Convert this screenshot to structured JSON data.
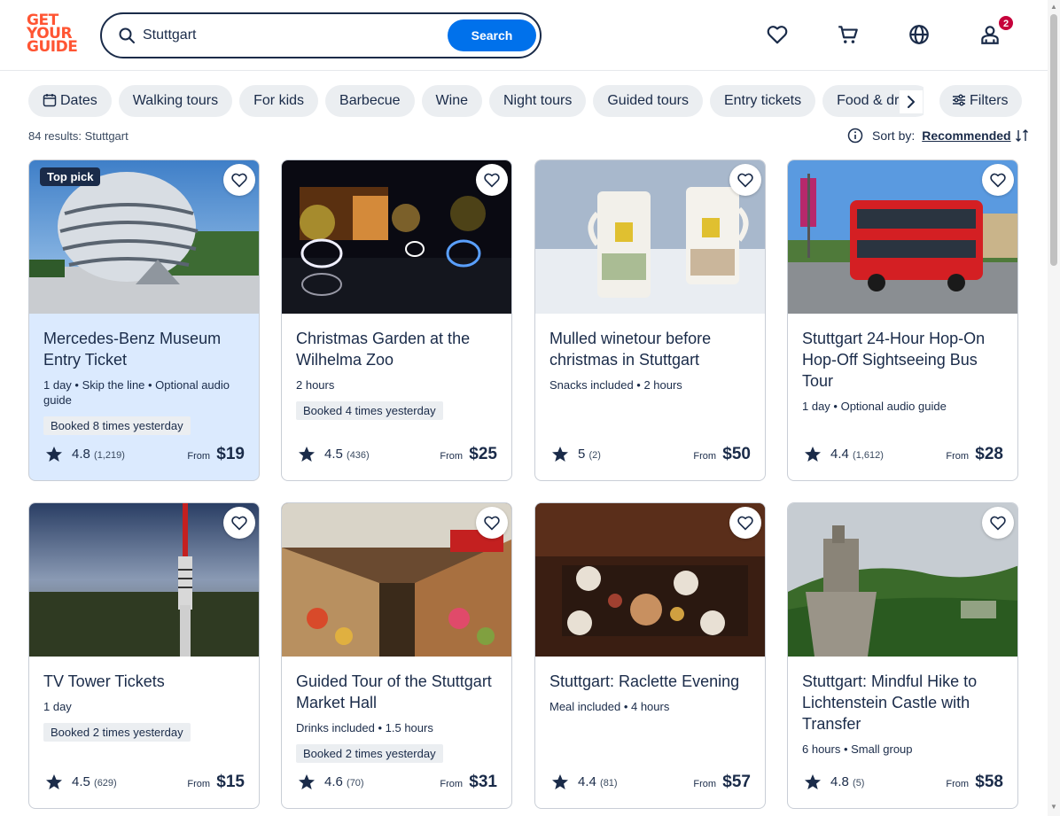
{
  "header": {
    "logo_lines": [
      "GET",
      "YOUR",
      "GUIDE"
    ],
    "search": {
      "value": "Stuttgart",
      "button_label": "Search"
    },
    "cart_badge": "2"
  },
  "chips": [
    {
      "label": "Dates",
      "icon": "calendar-icon"
    },
    {
      "label": "Walking tours"
    },
    {
      "label": "For kids"
    },
    {
      "label": "Barbecue"
    },
    {
      "label": "Wine"
    },
    {
      "label": "Night tours"
    },
    {
      "label": "Guided tours"
    },
    {
      "label": "Entry tickets"
    },
    {
      "label": "Food & drink"
    }
  ],
  "filters_label": "Filters",
  "results_text": "84 results: Stuttgart",
  "sort": {
    "label": "Sort by:",
    "value": "Recommended"
  },
  "cards": [
    {
      "title": "Mercedes-Benz Museum Entry Ticket",
      "meta": "1 day • Skip the line • Optional audio guide",
      "booked": "Booked 8 times yesterday",
      "rating": "4.8",
      "count": "(1,219)",
      "from": "From",
      "price": "$19",
      "badge": "Top pick"
    },
    {
      "title": "Christmas Garden at the Wilhelma Zoo",
      "meta": "2 hours",
      "booked": "Booked 4 times yesterday",
      "rating": "4.5",
      "count": "(436)",
      "from": "From",
      "price": "$25"
    },
    {
      "title": "Mulled winetour before christmas in Stuttgart",
      "meta": "Snacks included • 2 hours",
      "booked": "",
      "rating": "5",
      "count": "(2)",
      "from": "From",
      "price": "$50"
    },
    {
      "title": "Stuttgart 24-Hour Hop-On Hop-Off Sightseeing Bus Tour",
      "meta": "1 day • Optional audio guide",
      "booked": "",
      "rating": "4.4",
      "count": "(1,612)",
      "from": "From",
      "price": "$28"
    },
    {
      "title": "TV Tower Tickets",
      "meta": "1 day",
      "booked": "Booked 2 times yesterday",
      "rating": "4.5",
      "count": "(629)",
      "from": "From",
      "price": "$15"
    },
    {
      "title": "Guided Tour of the Stuttgart Market Hall",
      "meta": "Drinks included • 1.5 hours",
      "booked": "Booked 2 times yesterday",
      "rating": "4.6",
      "count": "(70)",
      "from": "From",
      "price": "$31"
    },
    {
      "title": "Stuttgart: Raclette Evening",
      "meta": "Meal included • 4 hours",
      "booked": "",
      "rating": "4.4",
      "count": "(81)",
      "from": "From",
      "price": "$57"
    },
    {
      "title": "Stuttgart: Mindful Hike to Lichtenstein Castle with Transfer",
      "meta": "6 hours • Small group",
      "booked": "",
      "rating": "4.8",
      "count": "(5)",
      "from": "From",
      "price": "$58"
    }
  ],
  "colors": {
    "brand": "#ff5533",
    "accent": "#0071eb",
    "text": "#1a2b49",
    "badge": "#c6003b"
  }
}
